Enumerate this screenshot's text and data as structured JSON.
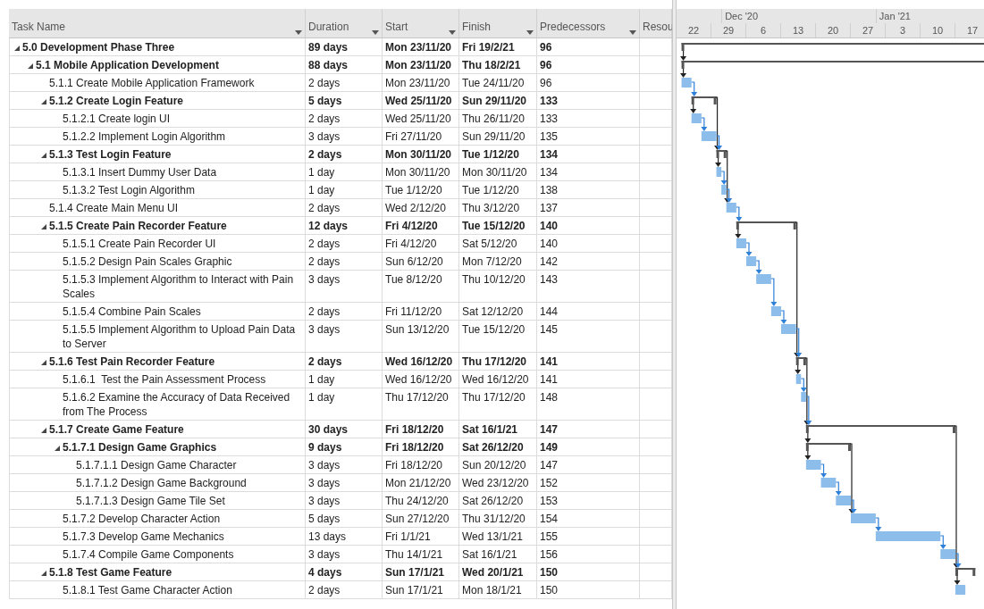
{
  "columns": [
    {
      "label": "Task Name"
    },
    {
      "label": "Duration"
    },
    {
      "label": "Start"
    },
    {
      "label": "Finish"
    },
    {
      "label": "Predecessors"
    },
    {
      "label": "Resou"
    }
  ],
  "timescale": {
    "months": [
      "Dec '20",
      "Jan '21"
    ],
    "weeks": [
      "22",
      "29",
      "6",
      "13",
      "20",
      "27",
      "3",
      "10",
      "17"
    ]
  },
  "tasks": [
    {
      "name": "5.0 Development Phase Three",
      "duration": "89 days",
      "start": "Mon 23/11/20",
      "finish": "Fri 19/2/21",
      "predecessors": "96",
      "expanded": true,
      "children": [
        {
          "name": "5.1 Mobile Application Development",
          "duration": "88 days",
          "start": "Mon 23/11/20",
          "finish": "Thu 18/2/21",
          "predecessors": "96",
          "expanded": true,
          "children": [
            {
              "name": "5.1.1 Create Mobile Application Framework",
              "duration": "2 days",
              "start": "Mon 23/11/20",
              "finish": "Tue 24/11/20",
              "predecessors": "96"
            },
            {
              "name": "5.1.2 Create Login Feature",
              "duration": "5 days",
              "start": "Wed 25/11/20",
              "finish": "Sun 29/11/20",
              "predecessors": "133",
              "expanded": true,
              "children": [
                {
                  "name": "5.1.2.1 Create login UI",
                  "duration": "2 days",
                  "start": "Wed 25/11/20",
                  "finish": "Thu 26/11/20",
                  "predecessors": "133"
                },
                {
                  "name": "5.1.2.2 Implement Login Algorithm",
                  "duration": "3 days",
                  "start": "Fri 27/11/20",
                  "finish": "Sun 29/11/20",
                  "predecessors": "135"
                }
              ]
            },
            {
              "name": "5.1.3 Test Login Feature",
              "duration": "2 days",
              "start": "Mon 30/11/20",
              "finish": "Tue 1/12/20",
              "predecessors": "134",
              "expanded": true,
              "children": [
                {
                  "name": "5.1.3.1 Insert Dummy User Data",
                  "duration": "1 day",
                  "start": "Mon 30/11/20",
                  "finish": "Mon 30/11/20",
                  "predecessors": "134"
                },
                {
                  "name": "5.1.3.2 Test Login Algorithm",
                  "duration": "1 day",
                  "start": "Tue 1/12/20",
                  "finish": "Tue 1/12/20",
                  "predecessors": "138"
                }
              ]
            },
            {
              "name": "5.1.4 Create Main Menu UI",
              "duration": "2 days",
              "start": "Wed 2/12/20",
              "finish": "Thu 3/12/20",
              "predecessors": "137"
            },
            {
              "name": "5.1.5 Create Pain Recorder Feature",
              "duration": "12 days",
              "start": "Fri 4/12/20",
              "finish": "Tue 15/12/20",
              "predecessors": "140",
              "expanded": true,
              "children": [
                {
                  "name": "5.1.5.1 Create Pain Recorder UI",
                  "duration": "2 days",
                  "start": "Fri 4/12/20",
                  "finish": "Sat 5/12/20",
                  "predecessors": "140"
                },
                {
                  "name": "5.1.5.2 Design Pain Scales Graphic",
                  "duration": "2 days",
                  "start": "Sun 6/12/20",
                  "finish": "Mon 7/12/20",
                  "predecessors": "142"
                },
                {
                  "name": "5.1.5.3 Implement Algorithm to Interact with Pain Scales",
                  "duration": "3 days",
                  "start": "Tue 8/12/20",
                  "finish": "Thu 10/12/20",
                  "predecessors": "143"
                },
                {
                  "name": "5.1.5.4 Combine Pain Scales",
                  "duration": "2 days",
                  "start": "Fri 11/12/20",
                  "finish": "Sat 12/12/20",
                  "predecessors": "144"
                },
                {
                  "name": "5.1.5.5 Implement Algorithm to Upload Pain Data to Server",
                  "duration": "3 days",
                  "start": "Sun 13/12/20",
                  "finish": "Tue 15/12/20",
                  "predecessors": "145"
                }
              ]
            },
            {
              "name": "5.1.6 Test Pain Recorder Feature",
              "duration": "2 days",
              "start": "Wed 16/12/20",
              "finish": "Thu 17/12/20",
              "predecessors": "141",
              "expanded": true,
              "children": [
                {
                  "name": "5.1.6.1  Test the Pain Assessment Process",
                  "duration": "1 day",
                  "start": "Wed 16/12/20",
                  "finish": "Wed 16/12/20",
                  "predecessors": "141"
                },
                {
                  "name": "5.1.6.2 Examine the Accuracy of Data Received from The Process",
                  "duration": "1 day",
                  "start": "Thu 17/12/20",
                  "finish": "Thu 17/12/20",
                  "predecessors": "148"
                }
              ]
            },
            {
              "name": "5.1.7 Create Game Feature",
              "duration": "30 days",
              "start": "Fri 18/12/20",
              "finish": "Sat 16/1/21",
              "predecessors": "147",
              "expanded": true,
              "children": [
                {
                  "name": "5.1.7.1 Design Game Graphics",
                  "duration": "9 days",
                  "start": "Fri 18/12/20",
                  "finish": "Sat 26/12/20",
                  "predecessors": "149",
                  "expanded": true,
                  "children": [
                    {
                      "name": "5.1.7.1.1 Design Game Character",
                      "duration": "3 days",
                      "start": "Fri 18/12/20",
                      "finish": "Sun 20/12/20",
                      "predecessors": "147"
                    },
                    {
                      "name": "5.1.7.1.2 Design Game Background",
                      "duration": "3 days",
                      "start": "Mon 21/12/20",
                      "finish": "Wed 23/12/20",
                      "predecessors": "152"
                    },
                    {
                      "name": "5.1.7.1.3 Design Game Tile Set",
                      "duration": "3 days",
                      "start": "Thu 24/12/20",
                      "finish": "Sat 26/12/20",
                      "predecessors": "153"
                    }
                  ]
                },
                {
                  "name": "5.1.7.2 Develop Character Action",
                  "duration": "5 days",
                  "start": "Sun 27/12/20",
                  "finish": "Thu 31/12/20",
                  "predecessors": "154"
                },
                {
                  "name": "5.1.7.3 Develop Game Mechanics",
                  "duration": "13 days",
                  "start": "Fri 1/1/21",
                  "finish": "Wed 13/1/21",
                  "predecessors": "155"
                },
                {
                  "name": "5.1.7.4 Compile Game Components",
                  "duration": "3 days",
                  "start": "Thu 14/1/21",
                  "finish": "Sat 16/1/21",
                  "predecessors": "156"
                }
              ]
            },
            {
              "name": "5.1.8 Test Game Feature",
              "duration": "4 days",
              "start": "Sun 17/1/21",
              "finish": "Wed 20/1/21",
              "predecessors": "150",
              "expanded": true,
              "children": [
                {
                  "name": "5.1.8.1 Test Game Character Action",
                  "duration": "2 days",
                  "start": "Sun 17/1/21",
                  "finish": "Mon 18/1/21",
                  "predecessors": "150"
                }
              ]
            }
          ]
        }
      ]
    }
  ]
}
